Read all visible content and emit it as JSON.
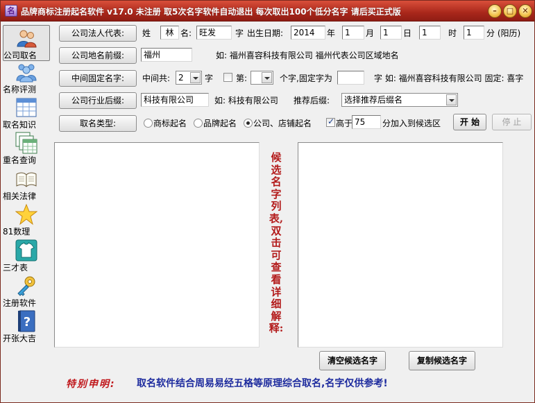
{
  "window": {
    "title": "品牌商标注册起名软件 v17.0  未注册  取5次名字软件自动退出 每次取出100个低分名字 请后买正式版",
    "app_icon_text": "名",
    "min_label": "–",
    "max_label": "□",
    "close_label": "✕"
  },
  "sidebar": {
    "items": [
      {
        "label": "公司取名",
        "icon": "users-icon"
      },
      {
        "label": "名称评测",
        "icon": "people-group-icon"
      },
      {
        "label": "取名知识",
        "icon": "table-icon"
      },
      {
        "label": "重名查询",
        "icon": "stacked-tables-icon"
      },
      {
        "label": "相关法律",
        "icon": "open-book-icon"
      },
      {
        "label": "81数理",
        "icon": "star-icon"
      },
      {
        "label": "三才表",
        "icon": "tshirt-icon"
      },
      {
        "label": "注册软件",
        "icon": "key-icon"
      },
      {
        "label": "开张大吉",
        "icon": "help-book-icon"
      }
    ]
  },
  "form": {
    "legal_rep_button": "公司法人代表:",
    "surname_label": "姓",
    "surname_value": "林",
    "givenname_label": "名:",
    "givenname_value": "旺发",
    "zi_label": "字",
    "birth_label": "出生日期:",
    "year_value": "2014",
    "year_label": "年",
    "month_value": "1",
    "month_label": "月",
    "day_value": "1",
    "day_label": "日",
    "hour_value": "1",
    "hour_label": "时",
    "minute_value": "1",
    "minute_label": "分  (阳历)",
    "prefix_button": "公司地名前缀:",
    "prefix_value": "福州",
    "prefix_hint": "如: 福州喜容科技有限公司 福州代表公司区域地名",
    "middle_button": "中间固定名字:",
    "middle_count_label": "中间共:",
    "middle_count_value": "2",
    "middle_zi_label": "字",
    "middle_pos_label": "第:",
    "middle_pos_value": "",
    "middle_fixed_label": "个字,固定字为",
    "middle_fixed_value": "",
    "middle_hint": "字  如: 福州喜容科技有限公司  固定: 喜字",
    "industry_button": "公司行业后缀:",
    "industry_value": "科技有限公司",
    "industry_hint": "如: 科技有限公司",
    "suggest_label": "推荐后缀:",
    "suggest_value": "选择推荐后缀名",
    "type_button": "取名类型:",
    "radio_trademark": "商标起名",
    "radio_brand": "品牌起名",
    "radio_company": "公司、店铺起名",
    "score_above_label": "高于",
    "score_value": "75",
    "score_suffix": "分加入到候选区",
    "start_button": "开  始",
    "stop_button": "停  止"
  },
  "candidates": {
    "vertical_note": "候选名字列表,双击可查看详细解释:",
    "clear_button": "清空候选名字",
    "copy_button": "复制候选名字"
  },
  "notice": {
    "title": "特别申明:",
    "body": "取名软件结合周易易经五格等原理综合取名,名字仅供参考!"
  },
  "colors": {
    "titlebar": "#b3291c",
    "notice_title": "#c0171b",
    "notice_body": "#1d2b9e",
    "vertical_note": "#b31b1b"
  }
}
